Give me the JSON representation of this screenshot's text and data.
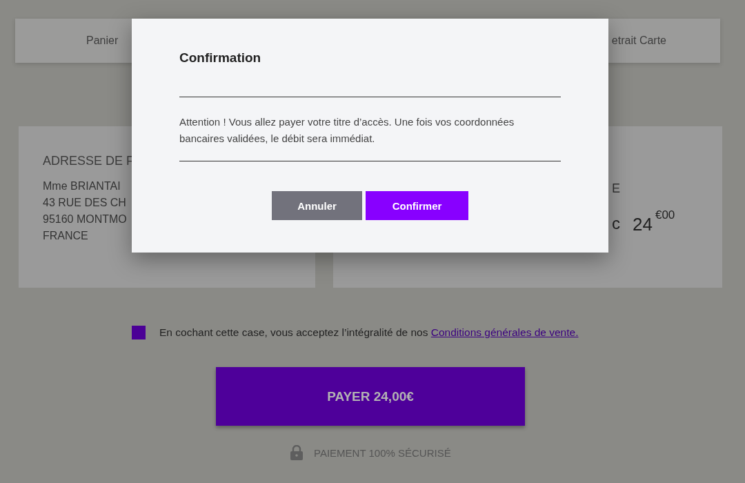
{
  "nav": {
    "items": [
      {
        "label": "Panier"
      },
      {
        "label": "etrait Carte"
      }
    ]
  },
  "billing_card": {
    "title": "ADRESSE DE F",
    "lines": [
      "Mme BRIANTAI",
      "43 RUE DES CH",
      "95160 MONTMO",
      "FRANCE"
    ]
  },
  "summary_card": {
    "label": "E",
    "price_prefix": "c",
    "price_main": "24",
    "price_cents": "€00"
  },
  "terms": {
    "checked": true,
    "text": "En cochant cette case, vous acceptez l’intégralité de nos",
    "link": "Conditions générales de vente."
  },
  "pay_button": {
    "label": "PAYER 24,00€"
  },
  "secure_note": "PAIEMENT 100% SÉCURISÉ",
  "dialog": {
    "title": "Confirmation",
    "message": "Attention ! Vous allez payer votre titre d’accès. Une fois vos coordonnées bancaires validées, le débit sera immédiat.",
    "buttons": [
      {
        "label": "Annuler",
        "kind": "secondary"
      },
      {
        "label": "Confirmer",
        "kind": "primary"
      }
    ]
  }
}
